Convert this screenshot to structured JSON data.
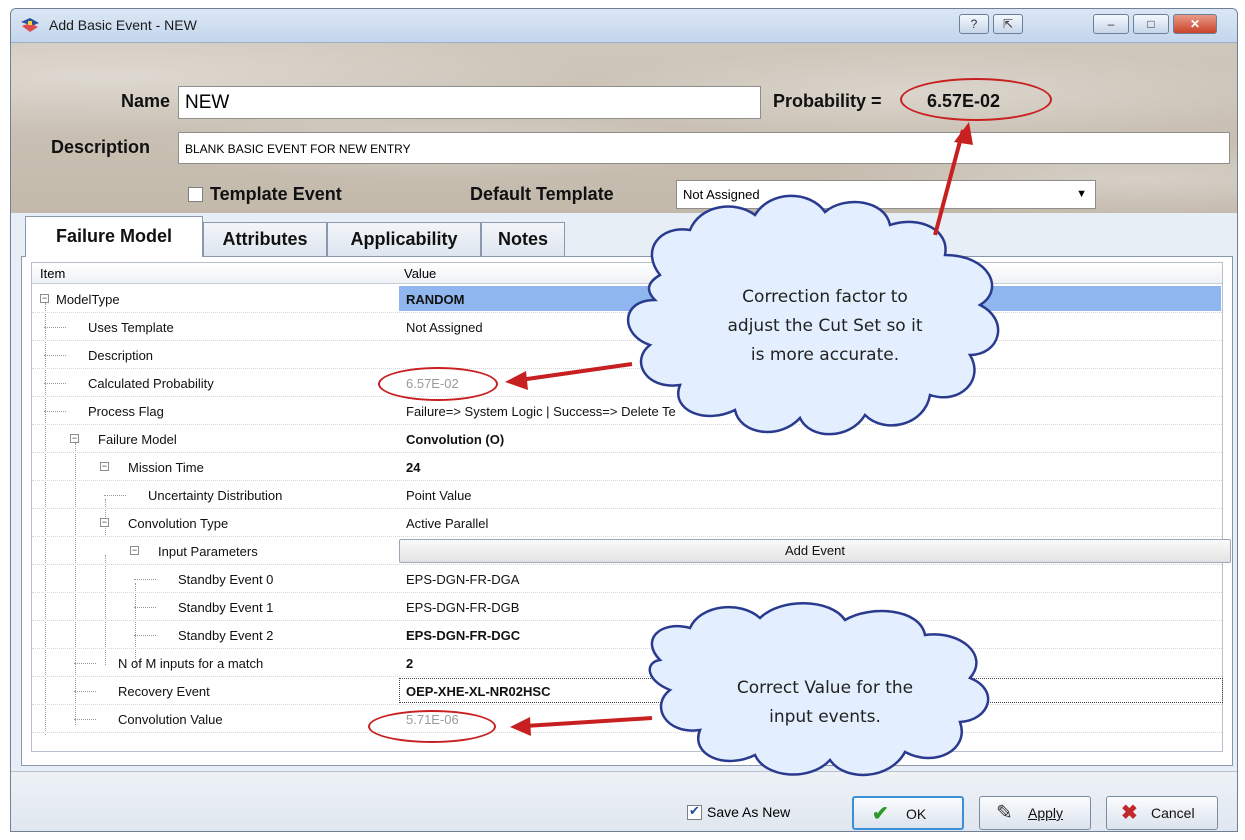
{
  "window": {
    "title": "Add Basic Event - NEW",
    "controls": [
      "?",
      "⇱",
      "–",
      "□",
      "✕"
    ]
  },
  "header": {
    "name_label": "Name",
    "name_value": "NEW",
    "probability_label": "Probability =",
    "probability_value": "6.57E-02",
    "description_label": "Description",
    "description_value": "BLANK BASIC EVENT FOR NEW ENTRY",
    "template_event_label": "Template Event",
    "template_event_checked": false,
    "default_template_label": "Default Template",
    "default_template_value": "Not Assigned"
  },
  "tabs": [
    {
      "label": "Failure Model",
      "active": true
    },
    {
      "label": "Attributes"
    },
    {
      "label": "Applicability"
    },
    {
      "label": "Notes"
    }
  ],
  "grid": {
    "col_item": "Item",
    "col_value": "Value",
    "rows": [
      {
        "item": "ModelType",
        "value": "RANDOM",
        "bold": true,
        "selected": true
      },
      {
        "item": "Uses Template",
        "value": "Not Assigned"
      },
      {
        "item": "Description",
        "value": ""
      },
      {
        "item": "Calculated Probability",
        "value": "6.57E-02",
        "gray": true
      },
      {
        "item": "Process Flag",
        "value": "Failure=> System Logic    | Success=> Delete Te"
      },
      {
        "item": "Failure Model",
        "value": "Convolution (O)",
        "bold": true
      },
      {
        "item": "Mission Time",
        "value": "24",
        "bold": true
      },
      {
        "item": "Uncertainty Distribution",
        "value": "Point Value"
      },
      {
        "item": "Convolution Type",
        "value": "Active Parallel"
      },
      {
        "item": "Input Parameters",
        "value": "Add Event",
        "button": true
      },
      {
        "item": "Standby Event 0",
        "value": "EPS-DGN-FR-DGA"
      },
      {
        "item": "Standby Event 1",
        "value": "EPS-DGN-FR-DGB"
      },
      {
        "item": "Standby Event 2",
        "value": "EPS-DGN-FR-DGC",
        "bold": true
      },
      {
        "item": "N of M inputs for a match",
        "value": "2",
        "bold": true
      },
      {
        "item": "Recovery Event",
        "value": "OEP-XHE-XL-NR02HSC",
        "bold": true
      },
      {
        "item": "Convolution Value",
        "value": "5.71E-06",
        "gray": true
      }
    ]
  },
  "callouts": {
    "top": [
      "Correction factor to",
      "adjust the Cut Set so it",
      "is more accurate."
    ],
    "bottom": [
      "Correct Value for the",
      "input events."
    ]
  },
  "footer": {
    "save_as_new_label": "Save As New",
    "save_as_new_checked": true,
    "ok_label": "OK",
    "apply_label": "Apply",
    "cancel_label": "Cancel"
  },
  "colors": {
    "accent_red": "#c82020",
    "selection": "#8fb6ee",
    "ok_icon": "#2e9a2e",
    "cancel_icon": "#c0282a"
  }
}
